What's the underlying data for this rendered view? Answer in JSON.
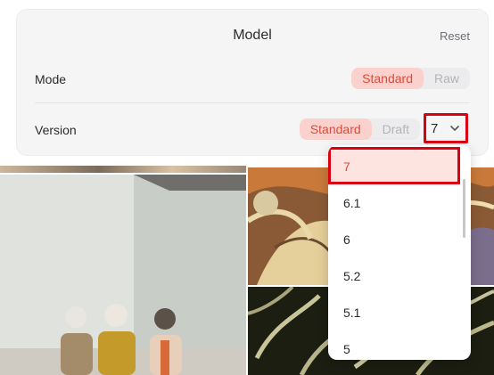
{
  "panel": {
    "title": "Model",
    "reset_label": "Reset"
  },
  "mode": {
    "label": "Mode",
    "options": [
      "Standard",
      "Raw"
    ],
    "selected": "Standard"
  },
  "version": {
    "label": "Version",
    "style_options": [
      "Standard",
      "Draft"
    ],
    "style_selected": "Standard",
    "select_value": "7"
  },
  "dropdown": {
    "options": [
      "7",
      "6.1",
      "6",
      "5.2",
      "5.1",
      "5"
    ],
    "selected": "7"
  },
  "colors": {
    "accent": "#dd4a3a",
    "accent_bg": "#fad1cc",
    "highlight_outline": "#d90012",
    "panel_bg": "#f5f5f6"
  },
  "gallery": {
    "images": [
      "women-looking-up-photo",
      "art-nouveau-swirl-painting",
      "tropical-leaves-print"
    ]
  }
}
